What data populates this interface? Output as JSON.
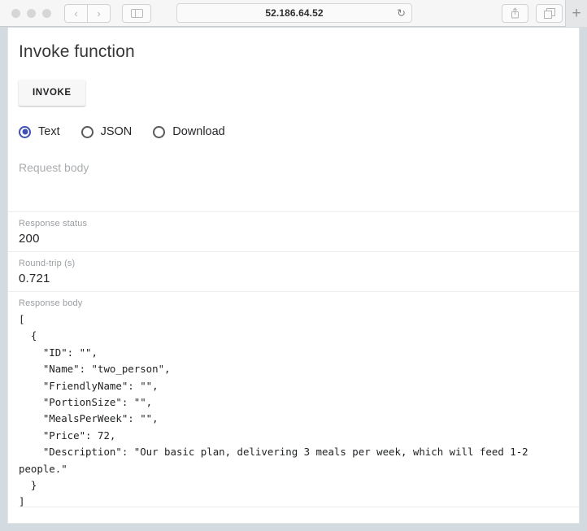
{
  "browser": {
    "traffic_lights": [
      "close",
      "minimize",
      "maximize"
    ],
    "back_icon": "‹",
    "forward_icon": "›",
    "sidebar_icon": "sidebar-toggle",
    "url": "52.186.64.52",
    "reload_icon": "↻",
    "share_icon": "share",
    "tabs_icon": "tab-overview",
    "new_tab_label": "+"
  },
  "page": {
    "title": "Invoke function",
    "invoke_label": "INVOKE",
    "output_modes": [
      {
        "label": "Text",
        "selected": true
      },
      {
        "label": "JSON",
        "selected": false
      },
      {
        "label": "Download",
        "selected": false
      }
    ],
    "request_body_placeholder": "Request body",
    "request_body_value": "",
    "response_status_label": "Response status",
    "response_status_value": "200",
    "round_trip_label": "Round-trip (s)",
    "round_trip_value": "0.721",
    "response_body_label": "Response body",
    "response_body_text": "[\n  {\n    \"ID\": \"\",\n    \"Name\": \"two_person\",\n    \"FriendlyName\": \"\",\n    \"PortionSize\": \"\",\n    \"MealsPerWeek\": \"\",\n    \"Price\": 72,\n    \"Description\": \"Our basic plan, delivering 3 meals per week, which will feed 1-2 people.\"\n  }\n]"
  },
  "colors": {
    "accent": "#3f51b5",
    "text": "#232427",
    "muted": "#9b9ea1",
    "divider": "#eceded"
  }
}
